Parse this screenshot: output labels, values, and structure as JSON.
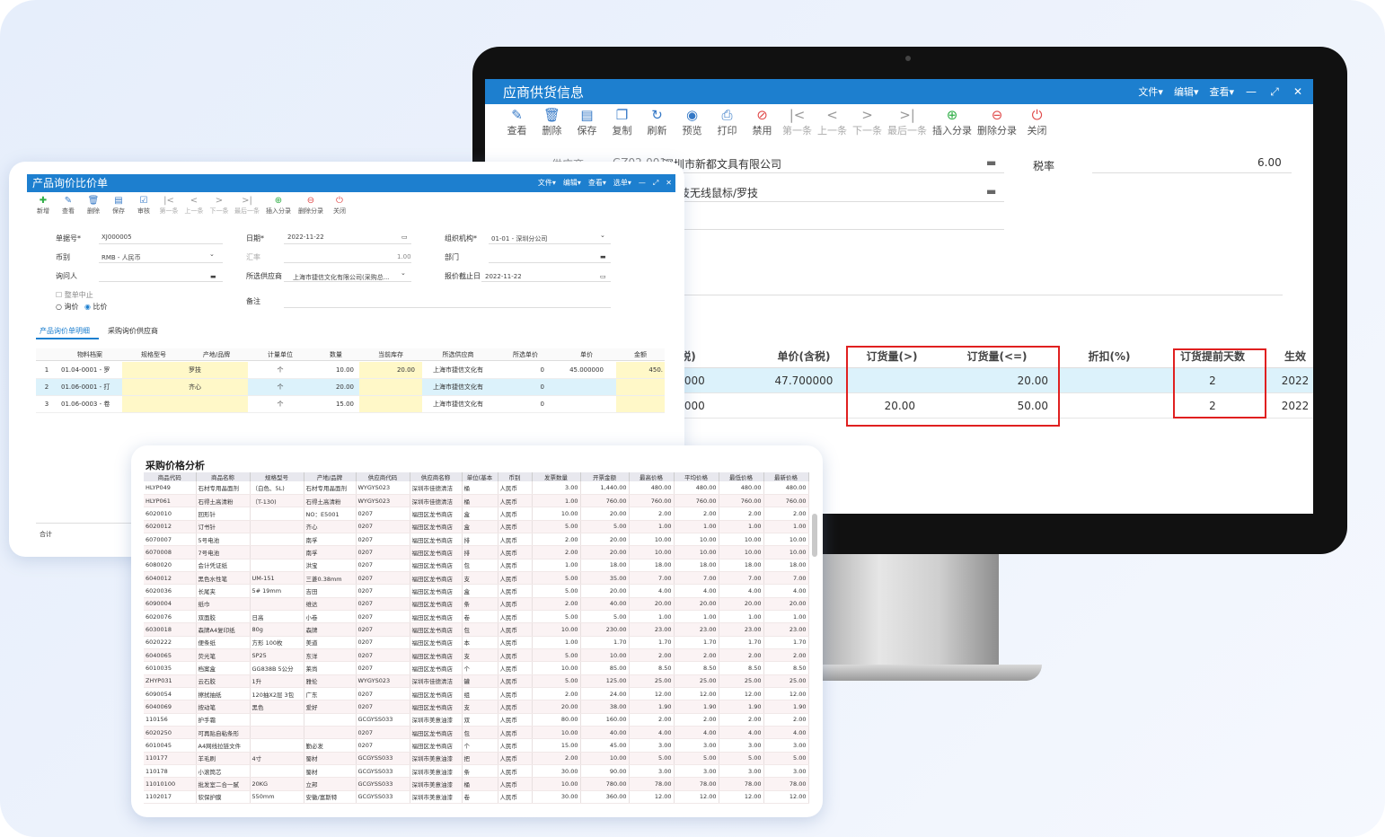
{
  "monitor": {
    "title": "应商供货信息",
    "menu": [
      "文件",
      "编辑",
      "查看"
    ],
    "toolbar": [
      {
        "label": "查看",
        "icon": "view-icon"
      },
      {
        "label": "删除",
        "icon": "trash-icon"
      },
      {
        "label": "保存",
        "icon": "save-icon"
      },
      {
        "label": "复制",
        "icon": "copy-icon"
      },
      {
        "label": "刷新",
        "icon": "refresh-icon"
      },
      {
        "label": "预览",
        "icon": "eye-icon"
      },
      {
        "label": "打印",
        "icon": "print-icon"
      },
      {
        "label": "禁用",
        "icon": "forbid-icon"
      },
      {
        "label": "第一条",
        "icon": "first-icon"
      },
      {
        "label": "上一条",
        "icon": "prev-icon"
      },
      {
        "label": "下一条",
        "icon": "next-icon"
      },
      {
        "label": "最后一条",
        "icon": "last-icon"
      },
      {
        "label": "插入分录",
        "icon": "plus-circle-icon"
      },
      {
        "label": "删除分录",
        "icon": "minus-circle-icon"
      },
      {
        "label": "关闭",
        "icon": "power-icon"
      }
    ],
    "supplier_label": "供应商",
    "supplier_code": "GZ02-001",
    "supplier_name": "深圳市新都文具有限公司",
    "product_name": "罗技无线鼠标/罗技",
    "tax_label": "税率",
    "tax_value": "6.00",
    "grid_headers": [
      "含税)",
      "单价(含税)",
      "订货量(>)",
      "订货量(<=)",
      "折扣(%)",
      "订货提前天数",
      "生效"
    ],
    "grid_rows": [
      [
        "000.000",
        "47.700000",
        "",
        "20.00",
        "",
        "2",
        "2022"
      ],
      [
        "000.000",
        "",
        "20.00",
        "50.00",
        "",
        "2",
        "2022"
      ]
    ]
  },
  "window1": {
    "title": "产品询价比价单",
    "menu": [
      "文件",
      "编辑",
      "查看",
      "选单"
    ],
    "toolbar": [
      "新增",
      "查看",
      "删除",
      "保存",
      "审核",
      "第一条",
      "上一条",
      "下一条",
      "最后一条",
      "插入分录",
      "删除分录",
      "关闭"
    ],
    "fields": {
      "doc_no_label": "单据号*",
      "doc_no": "XJ000005",
      "date_label": "日期*",
      "date": "2022-11-22",
      "org_label": "组织机构*",
      "org": "01-01 - 深圳分公司",
      "currency_label": "币别",
      "currency": "RMB - 人民币",
      "rate_label": "汇率",
      "rate": "1.00",
      "dept_label": "部门",
      "inquirer_label": "询问人",
      "supplier_label": "所选供应商",
      "supplier": "上海市捷信文化有限公司(采购总...",
      "deadline_label": "报价截止日",
      "deadline": "2022-11-22",
      "stop_label": "整单中止",
      "mode_ask": "询价",
      "mode_compare": "比价",
      "remark_label": "备注"
    },
    "tabs": [
      "产品询价单明细",
      "采购询价供应商"
    ],
    "headers": [
      "物料档案",
      "规格型号",
      "产地/品牌",
      "计量单位",
      "数量",
      "当前库存",
      "所选供应商",
      "所选单价",
      "单价",
      "金额"
    ],
    "rows": [
      [
        "1",
        "01.04-0001 - 罗",
        "",
        "罗技",
        "个",
        "10.00",
        "20.00",
        "上海市捷信文化有",
        "0",
        "45.000000",
        "450."
      ],
      [
        "2",
        "01.06-0001 - 打",
        "",
        "齐心",
        "个",
        "20.00",
        "",
        "上海市捷信文化有",
        "0",
        "",
        ""
      ],
      [
        "3",
        "01.06-0003 - 卷",
        "",
        "",
        "个",
        "15.00",
        "",
        "上海市捷信文化有",
        "0",
        "",
        ""
      ]
    ],
    "total_label": "合计"
  },
  "window2": {
    "title": "采购价格分析",
    "headers": [
      "商品代码",
      "商品名称",
      "规格型号",
      "产地/品牌",
      "供应商代码",
      "供应商名称",
      "单位(基本",
      "币别",
      "发票数量",
      "开票金额",
      "最高价格",
      "平均价格",
      "最低价格",
      "最新价格"
    ],
    "rows": [
      [
        "HLYP049",
        "石材专用晶面剂",
        "（白色、5L)",
        "石材专用晶面剂",
        "WYGYS023",
        "深圳市佳德清洁",
        "桶",
        "人民币",
        "3.00",
        "1,440.00",
        "480.00",
        "480.00",
        "480.00",
        "480.00"
      ],
      [
        "HLYP061",
        "石得土高清粉",
        "（T-130)",
        "石得土高清粉",
        "WYGYS023",
        "深圳市佳德清洁",
        "桶",
        "人民币",
        "1.00",
        "760.00",
        "760.00",
        "760.00",
        "760.00",
        "760.00"
      ],
      [
        "6020010",
        "回形针",
        "",
        "NO：E5001",
        "0207",
        "福田区龙书商店",
        "盒",
        "人民币",
        "10.00",
        "20.00",
        "2.00",
        "2.00",
        "2.00",
        "2.00"
      ],
      [
        "6020012",
        "订书针",
        "",
        "齐心",
        "0207",
        "福田区龙书商店",
        "盒",
        "人民币",
        "5.00",
        "5.00",
        "1.00",
        "1.00",
        "1.00",
        "1.00"
      ],
      [
        "6070007",
        "5号电池",
        "",
        "南孚",
        "0207",
        "福田区龙书商店",
        "排",
        "人民币",
        "2.00",
        "20.00",
        "10.00",
        "10.00",
        "10.00",
        "10.00"
      ],
      [
        "6070008",
        "7号电池",
        "",
        "南孚",
        "0207",
        "福田区龙书商店",
        "排",
        "人民币",
        "2.00",
        "20.00",
        "10.00",
        "10.00",
        "10.00",
        "10.00"
      ],
      [
        "6080020",
        "会计凭证纸",
        "",
        "洪宝",
        "0207",
        "福田区龙书商店",
        "包",
        "人民币",
        "1.00",
        "18.00",
        "18.00",
        "18.00",
        "18.00",
        "18.00"
      ],
      [
        "6040012",
        "黑色水性笔",
        "UM-151",
        "三菱0.38mm",
        "0207",
        "福田区龙书商店",
        "支",
        "人民币",
        "5.00",
        "35.00",
        "7.00",
        "7.00",
        "7.00",
        "7.00"
      ],
      [
        "6020036",
        "长尾夹",
        "5# 19mm",
        "吉田",
        "0207",
        "福田区龙书商店",
        "盒",
        "人民币",
        "5.00",
        "20.00",
        "4.00",
        "4.00",
        "4.00",
        "4.00"
      ],
      [
        "6090004",
        "纸巾",
        "",
        "维达",
        "0207",
        "福田区龙书商店",
        "条",
        "人民币",
        "2.00",
        "40.00",
        "20.00",
        "20.00",
        "20.00",
        "20.00"
      ],
      [
        "6020076",
        "双面胶",
        "日高",
        "小卷",
        "0207",
        "福田区龙书商店",
        "卷",
        "人民币",
        "5.00",
        "5.00",
        "1.00",
        "1.00",
        "1.00",
        "1.00"
      ],
      [
        "6030018",
        "森牌A4复印纸",
        "80g",
        "森牌",
        "0207",
        "福田区龙书商店",
        "包",
        "人民币",
        "10.00",
        "230.00",
        "23.00",
        "23.00",
        "23.00",
        "23.00"
      ],
      [
        "6020222",
        "便条纸",
        "方形 100枚",
        "美道",
        "0207",
        "福田区龙书商店",
        "本",
        "人民币",
        "1.00",
        "1.70",
        "1.70",
        "1.70",
        "1.70",
        "1.70"
      ],
      [
        "6040065",
        "荧光笔",
        "SP25",
        "东洋",
        "0207",
        "福田区龙书商店",
        "支",
        "人民币",
        "5.00",
        "10.00",
        "2.00",
        "2.00",
        "2.00",
        "2.00"
      ],
      [
        "6010035",
        "档案盒",
        "GG838B 5公分",
        "莱尚",
        "0207",
        "福田区龙书商店",
        "个",
        "人民币",
        "10.00",
        "85.00",
        "8.50",
        "8.50",
        "8.50",
        "8.50"
      ],
      [
        "ZHYP031",
        "云石胶",
        "1升",
        "雅伦",
        "WYGYS023",
        "深圳市佳德清洁",
        "罐",
        "人民币",
        "5.00",
        "125.00",
        "25.00",
        "25.00",
        "25.00",
        "25.00"
      ],
      [
        "6090054",
        "擦拭抽纸",
        "120抽X2层 3包",
        "广东",
        "0207",
        "福田区龙书商店",
        "组",
        "人民币",
        "2.00",
        "24.00",
        "12.00",
        "12.00",
        "12.00",
        "12.00"
      ],
      [
        "6040069",
        "按动笔",
        "黑色",
        "爱好",
        "0207",
        "福田区龙书商店",
        "支",
        "人民币",
        "20.00",
        "38.00",
        "1.90",
        "1.90",
        "1.90",
        "1.90"
      ],
      [
        "110156",
        "护手霜",
        "",
        "",
        "GCGYSS033",
        "深圳市美意油漆",
        "双",
        "人民币",
        "80.00",
        "160.00",
        "2.00",
        "2.00",
        "2.00",
        "2.00"
      ],
      [
        "6020250",
        "可再贴自粘条形",
        "",
        "",
        "0207",
        "福田区龙书商店",
        "包",
        "人民币",
        "10.00",
        "40.00",
        "4.00",
        "4.00",
        "4.00",
        "4.00"
      ],
      [
        "6010045",
        "A4网线拉链文件",
        "",
        "勤必发",
        "0207",
        "福田区龙书商店",
        "个",
        "人民币",
        "15.00",
        "45.00",
        "3.00",
        "3.00",
        "3.00",
        "3.00"
      ],
      [
        "110177",
        "羊毛刷",
        "4寸",
        "蜀材",
        "GCGYSS033",
        "深圳市美意油漆",
        "把",
        "人民币",
        "2.00",
        "10.00",
        "5.00",
        "5.00",
        "5.00",
        "5.00"
      ],
      [
        "110178",
        "小滚筒芯",
        "",
        "蜀材",
        "GCGYSS033",
        "深圳市美意油漆",
        "条",
        "人民币",
        "30.00",
        "90.00",
        "3.00",
        "3.00",
        "3.00",
        "3.00"
      ],
      [
        "11010100",
        "批发室二合一腻",
        "20KG",
        "立邦",
        "GCGYSS033",
        "深圳市美意油漆",
        "桶",
        "人民币",
        "10.00",
        "780.00",
        "78.00",
        "78.00",
        "78.00",
        "78.00"
      ],
      [
        "1102017",
        "软保护膜",
        "550mm",
        "安徽/富斯特",
        "GCGYSS033",
        "深圳市美意油漆",
        "卷",
        "人民币",
        "30.00",
        "360.00",
        "12.00",
        "12.00",
        "12.00",
        "12.00"
      ]
    ]
  }
}
